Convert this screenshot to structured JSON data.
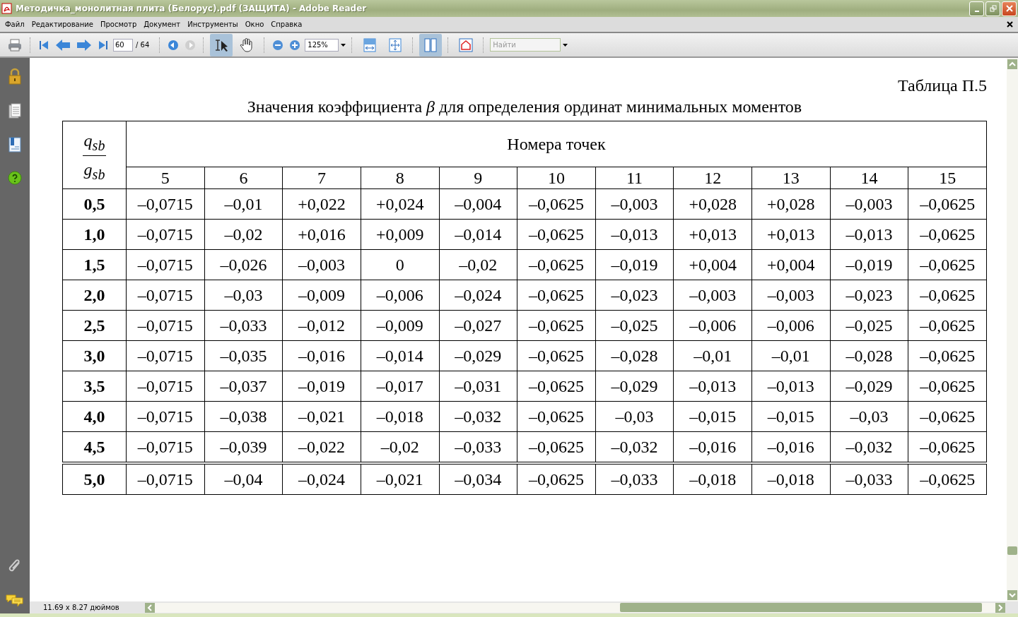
{
  "window": {
    "title": "Методичка_монолитная плита (Белорус).pdf (ЗАЩИТА) - Adobe Reader"
  },
  "menu": [
    "Файл",
    "Редактирование",
    "Просмотр",
    "Документ",
    "Инструменты",
    "Окно",
    "Справка"
  ],
  "toolbar": {
    "page": "60",
    "page_total": "/ 64",
    "zoom": "125%",
    "search": {
      "placeholder": "Найти"
    },
    "tools": [
      {
        "kind": "select",
        "selected": true
      },
      {
        "kind": "hand",
        "selected": false
      }
    ],
    "views": [
      {
        "kind": "fit-width",
        "selected": false
      },
      {
        "kind": "fit-page",
        "selected": false
      },
      {
        "kind": "two-page",
        "selected": true
      }
    ]
  },
  "document": {
    "caption": "Таблица П.5",
    "title": "Значения коэффициента *β* для определения ординат минимальных моментов",
    "table": {
      "ratio": {
        "numerator": "q$_{sb}$",
        "denominator": "g$_{sb}$"
      },
      "group_header": "Номера точек",
      "columns": [
        "5",
        "6",
        "7",
        "8",
        "9",
        "10",
        "11",
        "12",
        "13",
        "14",
        "15"
      ],
      "rows": [
        {
          "label": "0,5",
          "separated": false,
          "values": [
            "–0,0715",
            "–0,01",
            "+0,022",
            "+0,024",
            "–0,004",
            "–0,0625",
            "–0,003",
            "+0,028",
            "+0,028",
            "–0,003",
            "–0,0625"
          ]
        },
        {
          "label": "1,0",
          "separated": false,
          "values": [
            "–0,0715",
            "–0,02",
            "+0,016",
            "+0,009",
            "–0,014",
            "–0,0625",
            "–0,013",
            "+0,013",
            "+0,013",
            "–0,013",
            "–0,0625"
          ]
        },
        {
          "label": "1,5",
          "separated": false,
          "values": [
            "–0,0715",
            "–0,026",
            "–0,003",
            "0",
            "–0,02",
            "–0,0625",
            "–0,019",
            "+0,004",
            "+0,004",
            "–0,019",
            "–0,0625"
          ]
        },
        {
          "label": "2,0",
          "separated": false,
          "values": [
            "–0,0715",
            "–0,03",
            "–0,009",
            "–0,006",
            "–0,024",
            "–0,0625",
            "–0,023",
            "–0,003",
            "–0,003",
            "–0,023",
            "–0,0625"
          ]
        },
        {
          "label": "2,5",
          "separated": false,
          "values": [
            "–0,0715",
            "–0,033",
            "–0,012",
            "–0,009",
            "–0,027",
            "–0,0625",
            "–0,025",
            "–0,006",
            "–0,006",
            "–0,025",
            "–0,0625"
          ]
        },
        {
          "label": "3,0",
          "separated": false,
          "values": [
            "–0,0715",
            "–0,035",
            "–0,016",
            "–0,014",
            "–0,029",
            "–0,0625",
            "–0,028",
            "–0,01",
            "–0,01",
            "–0,028",
            "–0,0625"
          ]
        },
        {
          "label": "3,5",
          "separated": false,
          "values": [
            "–0,0715",
            "–0,037",
            "–0,019",
            "–0,017",
            "–0,031",
            "–0,0625",
            "–0,029",
            "–0,013",
            "–0,013",
            "–0,029",
            "–0,0625"
          ]
        },
        {
          "label": "4,0",
          "separated": false,
          "values": [
            "–0,0715",
            "–0,038",
            "–0,021",
            "–0,018",
            "–0,032",
            "–0,0625",
            "–0,03",
            "–0,015",
            "–0,015",
            "–0,03",
            "–0,0625"
          ]
        },
        {
          "label": "4,5",
          "separated": false,
          "values": [
            "–0,0715",
            "–0,039",
            "–0,022",
            "–0,02",
            "–0,033",
            "–0,0625",
            "–0,032",
            "–0,016",
            "–0,016",
            "–0,032",
            "–0,0625"
          ]
        },
        {
          "label": "5,0",
          "separated": true,
          "values": [
            "–0,0715",
            "–0,04",
            "–0,024",
            "–0,021",
            "–0,034",
            "–0,0625",
            "–0,033",
            "–0,018",
            "–0,018",
            "–0,033",
            "–0,0625"
          ]
        }
      ]
    }
  },
  "status_bar": {
    "page_size": "11.69 x 8.27 дюймов"
  }
}
